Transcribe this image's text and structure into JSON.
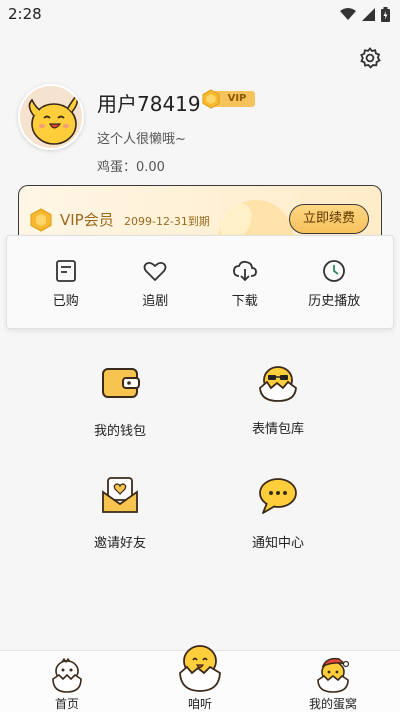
{
  "status_bar": {
    "time": "2:28"
  },
  "profile": {
    "username": "用户78419",
    "vip_badge": "VIP",
    "signature": "这个人很懒哦~",
    "eggs": "鸡蛋：0.00"
  },
  "vip_card": {
    "title": "VIP会员",
    "expire": "2099-12-31到期",
    "renew_label": "立即续费"
  },
  "quick_actions": [
    {
      "label": "已购",
      "icon": "purchased-icon"
    },
    {
      "label": "追剧",
      "icon": "heart-icon"
    },
    {
      "label": "下载",
      "icon": "download-icon"
    },
    {
      "label": "历史播放",
      "icon": "history-icon"
    }
  ],
  "grid": [
    {
      "label": "我的钱包",
      "icon": "wallet-icon"
    },
    {
      "label": "表情包库",
      "icon": "sticker-chick-icon"
    },
    {
      "label": "邀请好友",
      "icon": "invite-envelope-icon"
    },
    {
      "label": "通知中心",
      "icon": "message-bubble-icon"
    }
  ],
  "tabbar": [
    {
      "label": "首页",
      "icon": "home-egg-icon"
    },
    {
      "label": "咱听",
      "icon": "listen-chick-icon"
    },
    {
      "label": "我的蛋窝",
      "icon": "my-nest-icon"
    }
  ],
  "colors": {
    "accent": "#f5c25b",
    "vip_text": "#9a6a1c",
    "background": "#f6f6f6"
  }
}
